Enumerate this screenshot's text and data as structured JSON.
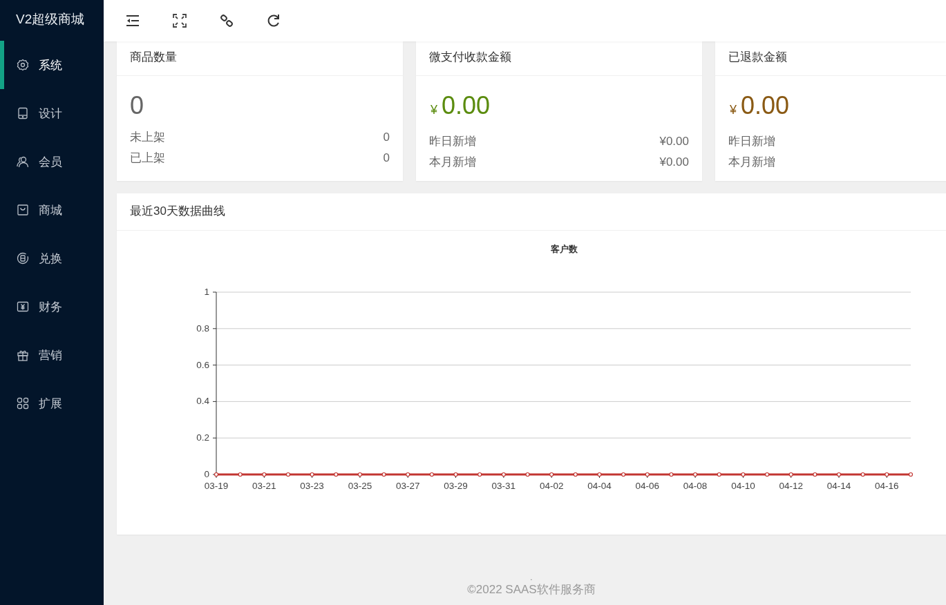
{
  "app": {
    "title": "V2超级商城"
  },
  "sidebar": {
    "items": [
      {
        "label": "系统",
        "selected": true
      },
      {
        "label": "设计",
        "selected": false
      },
      {
        "label": "会员",
        "selected": false
      },
      {
        "label": "商城",
        "selected": false
      },
      {
        "label": "兑换",
        "selected": false
      },
      {
        "label": "财务",
        "selected": false
      },
      {
        "label": "营销",
        "selected": false
      },
      {
        "label": "扩展",
        "selected": false
      }
    ]
  },
  "stat_cards": [
    {
      "title": "商品数量",
      "value": "0",
      "color": "#666666",
      "rows": [
        {
          "label": "未上架",
          "value": "0"
        },
        {
          "label": "已上架",
          "value": "0"
        }
      ]
    },
    {
      "title": "微支付收款金额",
      "currency": "¥",
      "value": "0.00",
      "color": "#5b8c0f",
      "rows": [
        {
          "label": "昨日新增",
          "value": "¥0.00"
        },
        {
          "label": "本月新增",
          "value": "¥0.00"
        }
      ]
    },
    {
      "title": "已退款金额",
      "currency": "¥",
      "value": "0.00",
      "color": "#8a5a14",
      "rows": [
        {
          "label": "昨日新增"
        },
        {
          "label": "本月新增"
        }
      ]
    }
  ],
  "chart_panel": {
    "title": "最近30天数据曲线",
    "chart_data": {
      "type": "line",
      "title": "客户数",
      "categories": [
        "03-19",
        null,
        "03-21",
        null,
        "03-23",
        null,
        "03-25",
        null,
        "03-27",
        null,
        "03-29",
        null,
        "03-31",
        null,
        "04-02",
        null,
        "04-04",
        null,
        "04-06",
        null,
        "04-08",
        null,
        "04-10",
        null,
        "04-12",
        null,
        "04-14",
        null,
        "04-16",
        null
      ],
      "series": [
        {
          "color": "#c23531",
          "marker": "circle",
          "values": [
            0,
            0,
            0,
            0,
            0,
            0,
            0,
            0,
            0,
            0,
            0,
            0,
            0,
            0,
            0,
            0,
            0,
            0,
            0,
            0,
            0,
            0,
            0,
            0,
            0,
            0,
            0,
            0,
            0,
            0
          ]
        }
      ],
      "grid": true,
      "ylim": [
        0,
        1
      ],
      "yticks": [
        0,
        0.2,
        0.4,
        0.6,
        0.8,
        1
      ]
    }
  },
  "footer": {
    "mark": ".",
    "text": "©2022 SAAS软件服务商"
  }
}
